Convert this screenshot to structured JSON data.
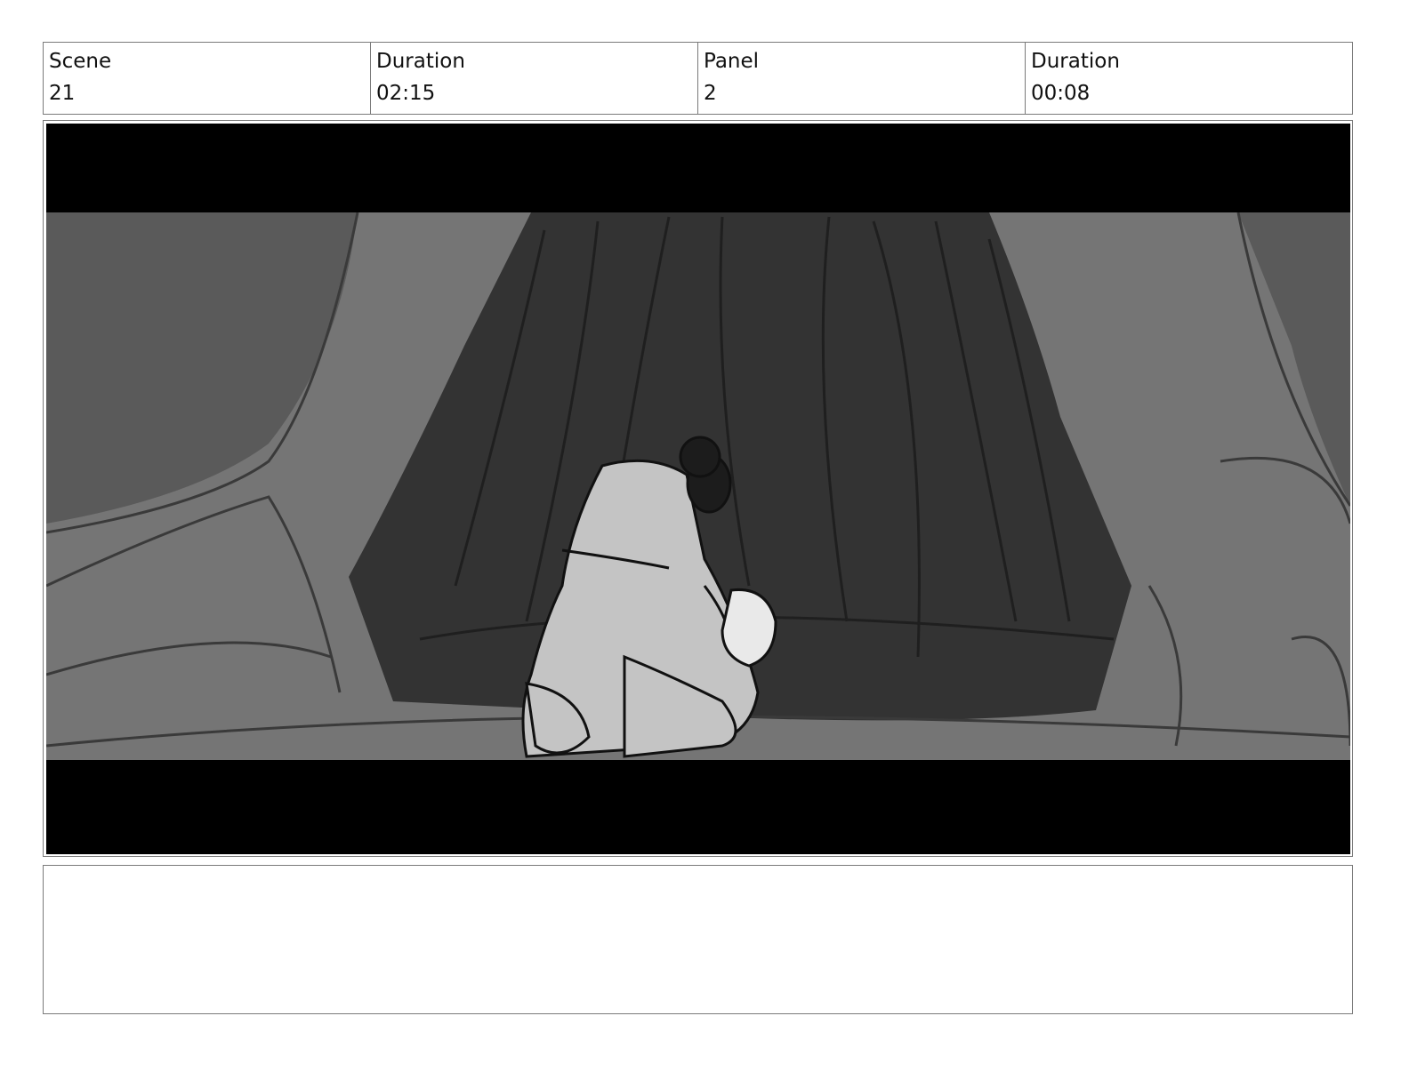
{
  "header": {
    "scene_label": "Scene",
    "scene_value": "21",
    "scene_duration_label": "Duration",
    "scene_duration_value": "02:15",
    "panel_label": "Panel",
    "panel_value": "2",
    "panel_duration_label": "Duration",
    "panel_duration_value": "00:08"
  },
  "notes": {
    "text": ""
  }
}
